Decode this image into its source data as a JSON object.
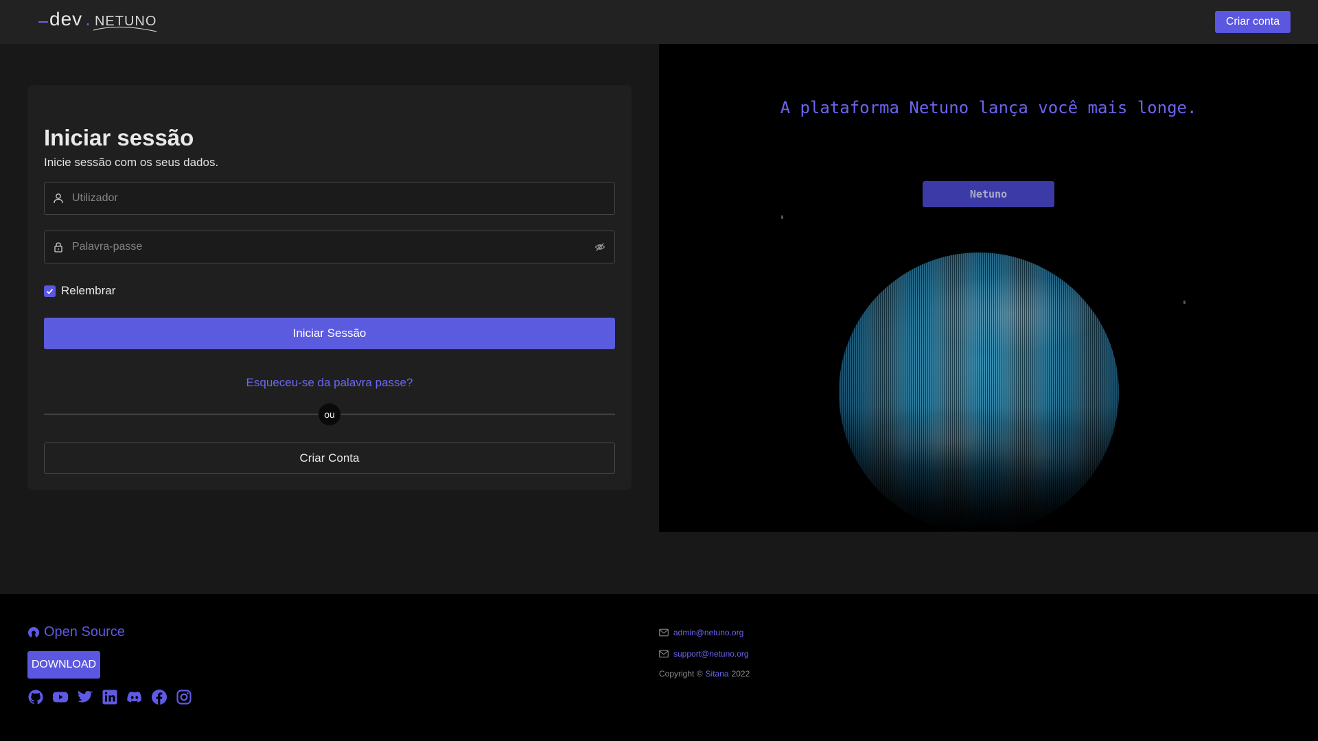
{
  "header": {
    "logo": {
      "prefix": "dev",
      "name": "NETUNO"
    },
    "create_account_label": "Criar conta"
  },
  "login": {
    "title": "Iniciar sessão",
    "subtitle": "Inicie sessão com os seus dados.",
    "username_placeholder": "Utilizador",
    "password_placeholder": "Palavra-passe",
    "remember_label": "Relembrar",
    "remember_checked": true,
    "submit_label": "Iniciar Sessão",
    "forgot_label": "Esqueceu-se da palavra passe?",
    "divider_label": "ou",
    "create_label": "Criar Conta"
  },
  "hero": {
    "tagline": "A plataforma Netuno lança você mais longe.",
    "badge": "Netuno"
  },
  "footer": {
    "open_source_label": "Open Source",
    "download_label": "DOWNLOAD",
    "socials": [
      "github-icon",
      "youtube-icon",
      "twitter-icon",
      "linkedin-icon",
      "discord-icon",
      "facebook-icon",
      "instagram-icon"
    ],
    "contacts": [
      "admin@netuno.org",
      "support@netuno.org"
    ],
    "copyright_prefix": "Copyright ©",
    "copyright_link": "Sitana",
    "copyright_year": "2022"
  },
  "colors": {
    "accent": "#5b57e0",
    "link": "#6a64f0",
    "background": "#181818",
    "card": "#1f1f1f"
  }
}
